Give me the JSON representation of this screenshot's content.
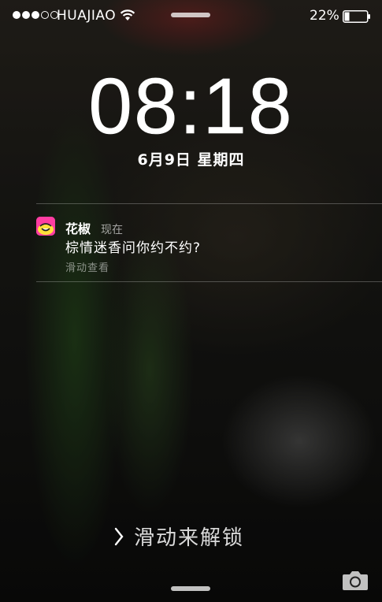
{
  "status_bar": {
    "signal_dots_filled": 3,
    "signal_dots_total": 5,
    "carrier": "HUAJIAO",
    "battery_percent_label": "22%",
    "battery_level": 0.22,
    "icons": [
      "signal-dots",
      "wifi-icon",
      "battery-icon"
    ]
  },
  "lock": {
    "time": "08:18",
    "date": "6月9日  星期四"
  },
  "notification": {
    "app_name": "花椒",
    "time": "现在",
    "message": "棕情迷香问你约不约?",
    "action_hint": "滑动查看",
    "icon": "huajiao-app-icon",
    "icon_color": "#ff3da2"
  },
  "unlock": {
    "label": "滑动来解锁",
    "icon": "chevron-right-icon"
  },
  "camera": {
    "icon": "camera-icon"
  }
}
